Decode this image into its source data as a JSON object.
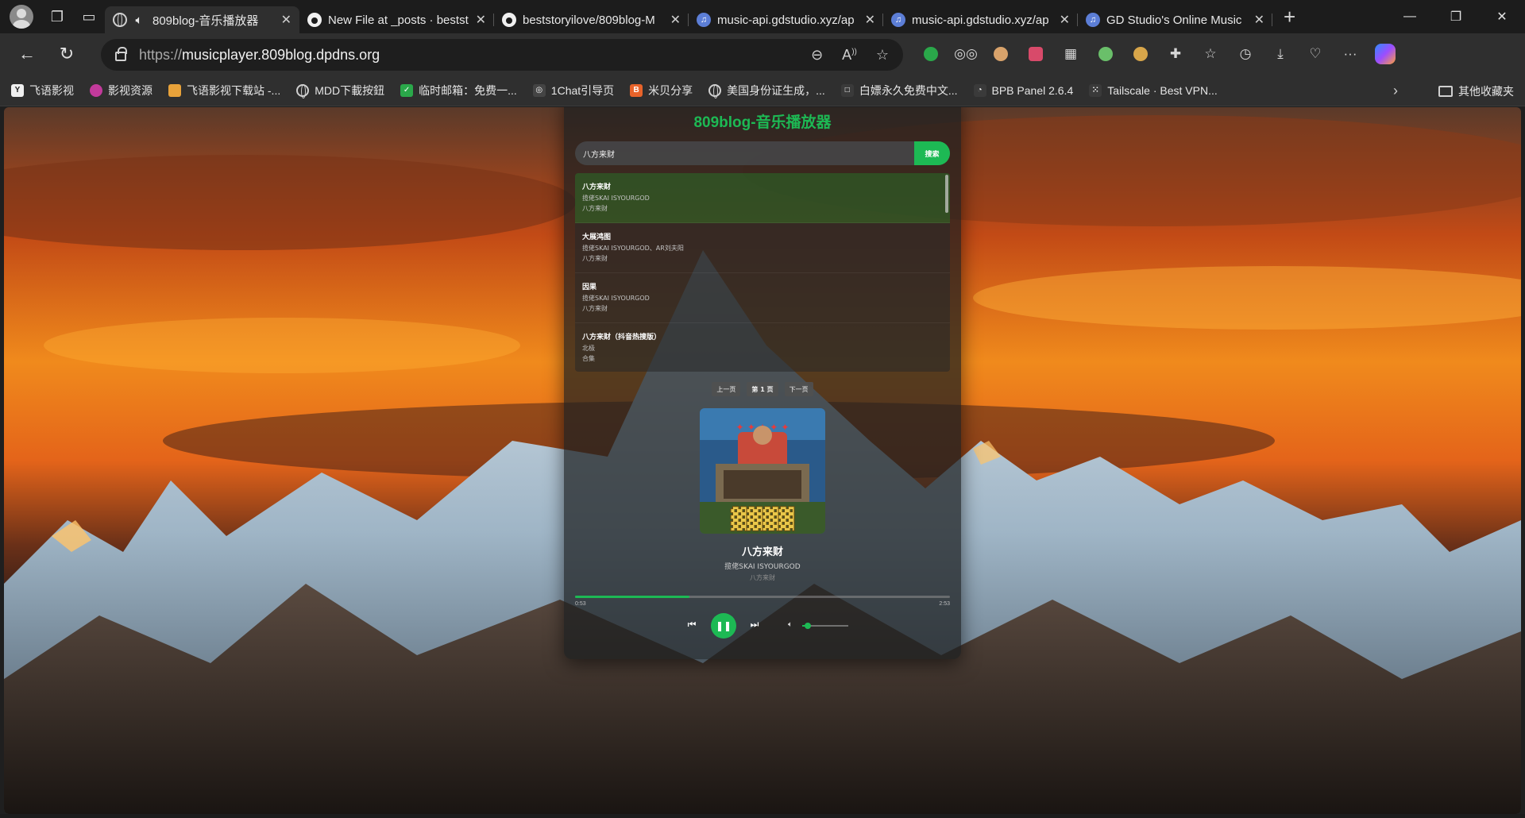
{
  "browser": {
    "tabs": [
      {
        "title": "809blog-音乐播放器",
        "icon": "globe-icon",
        "active": true,
        "audio": true
      },
      {
        "title": "New File at _posts · bestst",
        "icon": "github-icon",
        "active": false
      },
      {
        "title": "beststoryilove/809blog-M",
        "icon": "github-icon",
        "active": false
      },
      {
        "title": "music-api.gdstudio.xyz/ap",
        "icon": "music-icon",
        "active": false
      },
      {
        "title": "music-api.gdstudio.xyz/ap",
        "icon": "music-icon",
        "active": false
      },
      {
        "title": "GD Studio's Online Music",
        "icon": "music-icon",
        "active": false
      }
    ],
    "address": {
      "scheme": "https://",
      "host": "musicplayer.809blog.dpdns.org"
    },
    "bookmarks": [
      {
        "label": "飞语影视",
        "color": "#2b2b2b",
        "glyph": "Y"
      },
      {
        "label": "影视资源",
        "color": "#c23a9b",
        "glyph": "●"
      },
      {
        "label": "飞语影视下载站 -...",
        "color": "#e8a23a",
        "glyph": "▣"
      },
      {
        "label": "MDD下載按鈕",
        "color": "globe",
        "glyph": ""
      },
      {
        "label": "临时邮箱：免费一...",
        "color": "#2aa84a",
        "glyph": "✓"
      },
      {
        "label": "1Chat引导页",
        "color": "#444444",
        "glyph": "◎"
      },
      {
        "label": "米贝分享",
        "color": "#e8632a",
        "glyph": "B"
      },
      {
        "label": "美国身份证生成，...",
        "color": "globe",
        "glyph": ""
      },
      {
        "label": "白嫖永久免费中文...",
        "color": "#3a3a3a",
        "glyph": "□"
      },
      {
        "label": "BPB Panel 2.6.4",
        "color": "#3a3a3a",
        "glyph": "◔"
      },
      {
        "label": "Tailscale · Best VPN...",
        "color": "#3a3a3a",
        "glyph": "⁙"
      }
    ],
    "other_bookmarks": "其他收藏夹"
  },
  "player": {
    "title": "809blog-音乐播放器",
    "search": {
      "value": "八方来财",
      "button": "搜索"
    },
    "results": [
      {
        "title": "八方来财",
        "artist": "揽佬SKAI ISYOURGOD",
        "album": "八方来财",
        "active": true
      },
      {
        "title": "大展鸿图",
        "artist": "揽佬SKAI ISYOURGOD、AR刘夫阳",
        "album": "八方来财",
        "active": false
      },
      {
        "title": "因果",
        "artist": "揽佬SKAI ISYOURGOD",
        "album": "八方来财",
        "active": false
      },
      {
        "title": "八方来财（抖音热搜版）",
        "artist": "北极",
        "album": "合集",
        "active": false
      }
    ],
    "pager": {
      "prev": "上一页",
      "current": "第 1 页",
      "next": "下一页"
    },
    "now_playing": {
      "title": "八方来财",
      "artist": "揽佬SKAI ISYOURGOD",
      "album": "八方来财",
      "current_time": "0:53",
      "duration": "2:53",
      "progress": 0.306
    },
    "volume": 0.12,
    "colors": {
      "accent": "#1db954"
    }
  }
}
